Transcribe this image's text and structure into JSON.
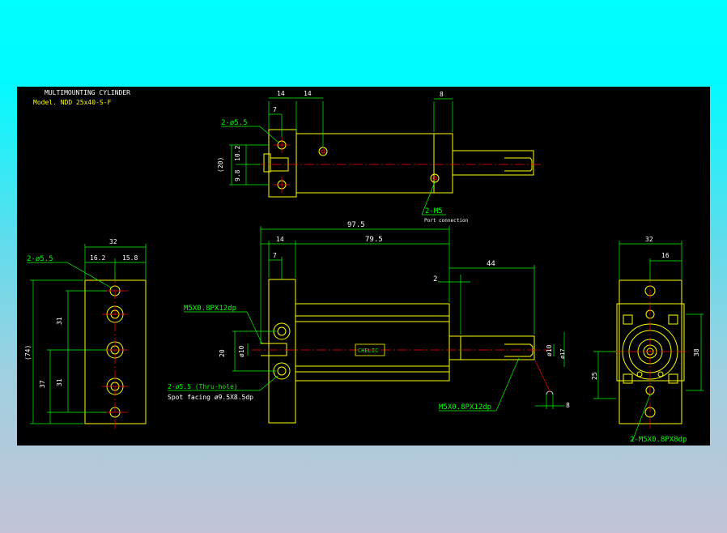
{
  "title": {
    "line1": "MULTIMOUNTING CYLINDER",
    "line2": "Model. NDD 25x40-S-F"
  },
  "colors": {
    "frame_bg": "#00ffff",
    "drawing_bg": "#000000",
    "outline": "#ffff00",
    "dimension": "#00ff00",
    "centerline": "#ff0000",
    "hidden": "#ff00ff"
  },
  "top_view": {
    "dim_14_left": "14",
    "dim_14_right": "14",
    "dim_7": "7",
    "dim_8": "8",
    "dim_20": "(20)",
    "dim_10_2": "10.2",
    "dim_9_8": "9.8",
    "hole_label": "2-ø5.5",
    "port_label": "2-M5",
    "port_note": "Port connection"
  },
  "left_view": {
    "dim_32": "32",
    "dim_16_2": "16.2",
    "dim_15_8": "15.8",
    "hole_label": "2-ø5.5",
    "dim_74": "(74)",
    "dim_31_a": "31",
    "dim_31_b": "31",
    "dim_37": "37"
  },
  "front_view": {
    "dim_97_5": "97.5",
    "dim_79_5": "79.5",
    "dim_14": "14",
    "dim_7": "7",
    "dim_44": "44",
    "dim_2": "2",
    "dim_20": "20",
    "dim_10_left": "ø10",
    "dim_10_right": "ø10",
    "dim_17": "ø17",
    "thread_left": "M5X0.8PX12dp",
    "thread_right": "M5X0.8PX12dp",
    "hole_note": "2-ø5.5 (Thru-hole)",
    "spot_note": "Spot facing ø9.5X8.5dp",
    "dim_8": "8",
    "brand": "CHELIC"
  },
  "right_view": {
    "dim_32": "32",
    "dim_16": "16",
    "dim_38": "38",
    "dim_25": "25",
    "thread_label": "2-M5X0.8PX8dp"
  }
}
